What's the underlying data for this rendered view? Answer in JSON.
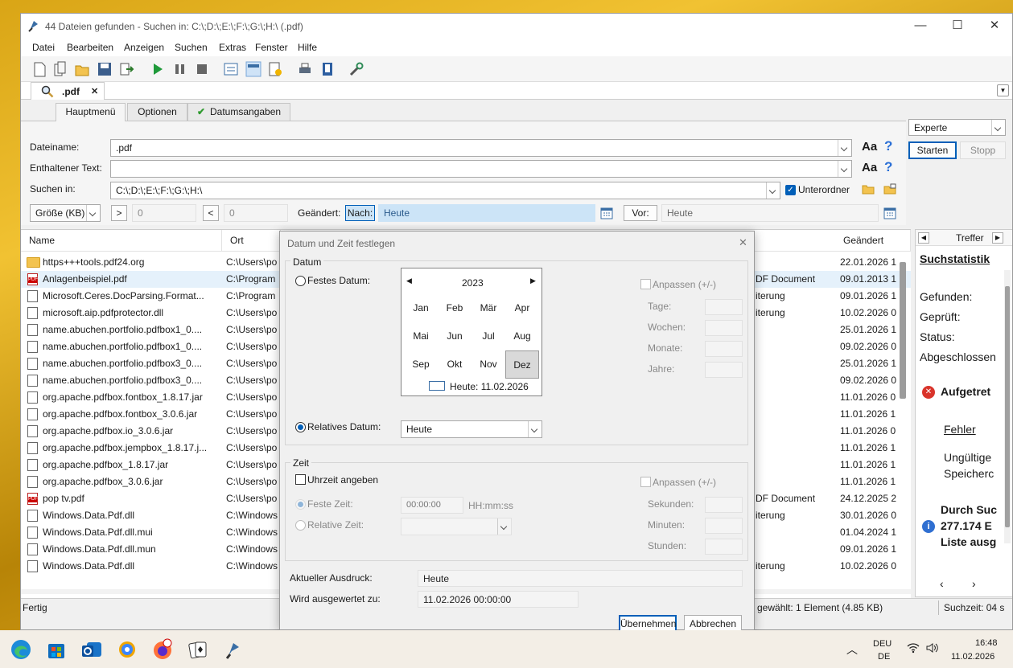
{
  "window": {
    "title": "44 Dateien gefunden - Suchen in: C:\\;D:\\;E:\\;F:\\;G:\\;H:\\ (.pdf)",
    "minimize": "—",
    "maximize": "☐",
    "close": "✕"
  },
  "menu": [
    "Datei",
    "Bearbeiten",
    "Anzeigen",
    "Suchen",
    "Extras",
    "Fenster",
    "Hilfe"
  ],
  "doc_tab": {
    "label": ".pdf",
    "close": "✕"
  },
  "panel_tabs": [
    "Hauptmenü",
    "Optionen",
    "Datumsangaben"
  ],
  "form": {
    "dateiname_label": "Dateiname:",
    "dateiname_value": ".pdf",
    "enthaltener_label": "Enthaltener Text:",
    "enthaltener_value": "",
    "suchen_label": "Suchen in:",
    "suchen_value": "C:\\;D:\\;E:\\;F:\\;G:\\;H:\\",
    "unterordner": "Unterordner",
    "groesse": "Größe (KB)",
    "gt": ">",
    "gt_val": "0",
    "lt": "<",
    "lt_val": "0",
    "geaendert": "Geändert:",
    "nach": "Nach:",
    "nach_val": "Heute",
    "vor": "Vor:",
    "vor_val": "Heute",
    "aa": "Aa",
    "help": "?"
  },
  "right_panel": {
    "mode": "Experte",
    "start": "Starten",
    "stop": "Stopp"
  },
  "columns": {
    "name": "Name",
    "ort": "Ort",
    "geaendert": "Geändert"
  },
  "rows": [
    {
      "icon": "folder",
      "name": "https+++tools.pdf24.org",
      "ort": "C:\\Users\\po",
      "typ": "",
      "date": "22.01.2026 1"
    },
    {
      "icon": "pdf",
      "name": "Anlagenbeispiel.pdf",
      "ort": "C:\\Program",
      "typ": "DF Document",
      "date": "09.01.2013 1"
    },
    {
      "icon": "dll",
      "name": "Microsoft.Ceres.DocParsing.Format...",
      "ort": "C:\\Program",
      "typ": "iterung",
      "date": "09.01.2026 1"
    },
    {
      "icon": "dll",
      "name": "microsoft.aip.pdfprotector.dll",
      "ort": "C:\\Users\\po",
      "typ": "iterung",
      "date": "10.02.2026 0"
    },
    {
      "icon": "file",
      "name": "name.abuchen.portfolio.pdfbox1_0....",
      "ort": "C:\\Users\\po",
      "typ": "",
      "date": "25.01.2026 1"
    },
    {
      "icon": "file",
      "name": "name.abuchen.portfolio.pdfbox1_0....",
      "ort": "C:\\Users\\po",
      "typ": "",
      "date": "09.02.2026 0"
    },
    {
      "icon": "file",
      "name": "name.abuchen.portfolio.pdfbox3_0....",
      "ort": "C:\\Users\\po",
      "typ": "",
      "date": "25.01.2026 1"
    },
    {
      "icon": "file",
      "name": "name.abuchen.portfolio.pdfbox3_0....",
      "ort": "C:\\Users\\po",
      "typ": "",
      "date": "09.02.2026 0"
    },
    {
      "icon": "file",
      "name": "org.apache.pdfbox.fontbox_1.8.17.jar",
      "ort": "C:\\Users\\po",
      "typ": "",
      "date": "11.01.2026 0"
    },
    {
      "icon": "file",
      "name": "org.apache.pdfbox.fontbox_3.0.6.jar",
      "ort": "C:\\Users\\po",
      "typ": "",
      "date": "11.01.2026 1"
    },
    {
      "icon": "file",
      "name": "org.apache.pdfbox.io_3.0.6.jar",
      "ort": "C:\\Users\\po",
      "typ": "",
      "date": "11.01.2026 0"
    },
    {
      "icon": "file",
      "name": "org.apache.pdfbox.jempbox_1.8.17.j...",
      "ort": "C:\\Users\\po",
      "typ": "",
      "date": "11.01.2026 1"
    },
    {
      "icon": "file",
      "name": "org.apache.pdfbox_1.8.17.jar",
      "ort": "C:\\Users\\po",
      "typ": "",
      "date": "11.01.2026 1"
    },
    {
      "icon": "file",
      "name": "org.apache.pdfbox_3.0.6.jar",
      "ort": "C:\\Users\\po",
      "typ": "",
      "date": "11.01.2026 1"
    },
    {
      "icon": "pdf",
      "name": "pop tv.pdf",
      "ort": "C:\\Users\\po",
      "typ": "DF Document",
      "date": "24.12.2025 2"
    },
    {
      "icon": "dll",
      "name": "Windows.Data.Pdf.dll",
      "ort": "C:\\Windows",
      "typ": "iterung",
      "date": "30.01.2026 0"
    },
    {
      "icon": "file",
      "name": "Windows.Data.Pdf.dll.mui",
      "ort": "C:\\Windows",
      "typ": "",
      "date": "01.04.2024 1"
    },
    {
      "icon": "file",
      "name": "Windows.Data.Pdf.dll.mun",
      "ort": "C:\\Windows",
      "typ": "",
      "date": "09.01.2026 1"
    },
    {
      "icon": "dll",
      "name": "Windows.Data.Pdf.dll",
      "ort": "C:\\Windows",
      "typ": "iterung",
      "date": "10.02.2026 0"
    }
  ],
  "sidebar": {
    "tab": "Treffer",
    "title": "Suchstatistik",
    "gefunden": "Gefunden:",
    "geprueft": "Geprüft:",
    "status": "Status:",
    "abgeschlossen": "Abgeschlossen",
    "aufgetreten": "Aufgetret",
    "fehler": "Fehler",
    "ungueltig": "Ungültige",
    "speicher": "Speicherc",
    "durch1": "Durch Suc",
    "durch2": "277.174 E",
    "durch3": "Liste ausg"
  },
  "statusbar": {
    "left": "Fertig",
    "mid": "gewählt: 1 Element (4.85 KB)",
    "right": "Suchzeit: 04 s"
  },
  "dialog": {
    "title": "Datum und Zeit festlegen",
    "close": "✕",
    "datum_group": "Datum",
    "festes": "Festes Datum:",
    "relatives": "Relatives Datum:",
    "relatives_val": "Heute",
    "year": "2023",
    "months": [
      "Jan",
      "Feb",
      "Mär",
      "Apr",
      "Mai",
      "Jun",
      "Jul",
      "Aug",
      "Sep",
      "Okt",
      "Nov",
      "Dez"
    ],
    "selected_month": "Dez",
    "today": "Heute: 11.02.2026",
    "anpassen": "Anpassen (+/-)",
    "tage": "Tage:",
    "wochen": "Wochen:",
    "monate": "Monate:",
    "jahre": "Jahre:",
    "zeit_group": "Zeit",
    "uhrzeit": "Uhrzeit angeben",
    "feste_zeit": "Feste Zeit:",
    "feste_zeit_val": "00:00:00",
    "format": "HH:mm:ss",
    "relative_zeit": "Relative Zeit:",
    "anpassen2": "Anpassen (+/-)",
    "sekunden": "Sekunden:",
    "minuten": "Minuten:",
    "stunden": "Stunden:",
    "ausdruck_label": "Aktueller Ausdruck:",
    "ausdruck_val": "Heute",
    "ausgewertet_label": "Wird ausgewertet zu:",
    "ausgewertet_val": "11.02.2026 00:00:00",
    "ok": "Übernehmen",
    "cancel": "Abbrechen"
  },
  "taskbar": {
    "lang1": "DEU",
    "lang2": "DE",
    "time": "16:48",
    "date": "11.02.2026"
  }
}
